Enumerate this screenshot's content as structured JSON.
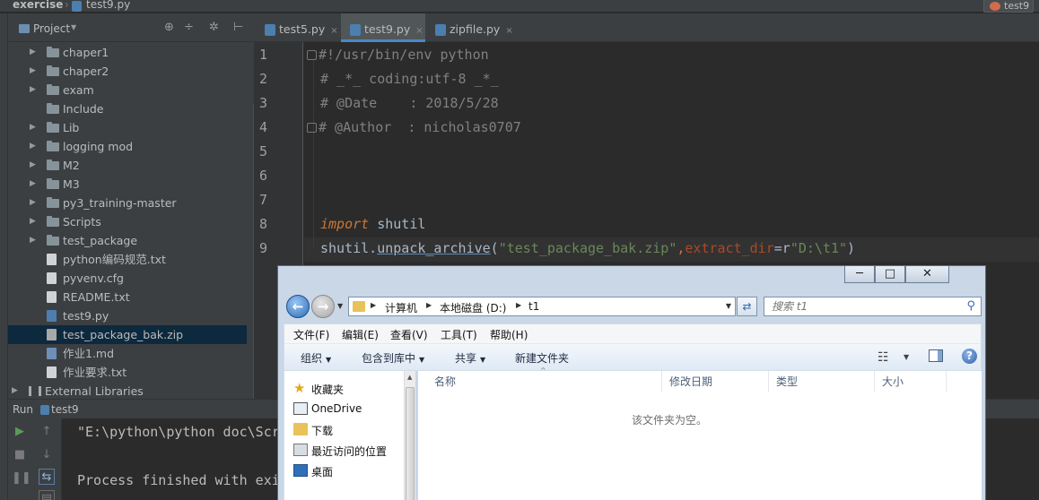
{
  "navbar": {
    "project": "exercise",
    "file": "test9.py",
    "run_config": "test9"
  },
  "project_panel": {
    "title": "Project",
    "tree": [
      {
        "label": "chaper1",
        "type": "folder",
        "indent": 1,
        "arrow": true
      },
      {
        "label": "chaper2",
        "type": "folder",
        "indent": 1,
        "arrow": true
      },
      {
        "label": "exam",
        "type": "folder",
        "indent": 1,
        "arrow": true
      },
      {
        "label": "Include",
        "type": "folder",
        "indent": 1,
        "arrow": false
      },
      {
        "label": "Lib",
        "type": "folder",
        "indent": 1,
        "arrow": true
      },
      {
        "label": "logging mod",
        "type": "folder",
        "indent": 1,
        "arrow": true
      },
      {
        "label": "M2",
        "type": "folder",
        "indent": 1,
        "arrow": true
      },
      {
        "label": "M3",
        "type": "folder",
        "indent": 1,
        "arrow": true
      },
      {
        "label": "py3_training-master",
        "type": "folder",
        "indent": 1,
        "arrow": true
      },
      {
        "label": "Scripts",
        "type": "folder",
        "indent": 1,
        "arrow": true
      },
      {
        "label": "test_package",
        "type": "folder",
        "indent": 1,
        "arrow": true
      },
      {
        "label": "python编码规范.txt",
        "type": "file",
        "indent": 1,
        "arrow": false
      },
      {
        "label": "pyvenv.cfg",
        "type": "file",
        "indent": 1,
        "arrow": false
      },
      {
        "label": "README.txt",
        "type": "file",
        "indent": 1,
        "arrow": false
      },
      {
        "label": "test9.py",
        "type": "py",
        "indent": 1,
        "arrow": false
      },
      {
        "label": "test_package_bak.zip",
        "type": "zip",
        "indent": 1,
        "arrow": false,
        "selected": true
      },
      {
        "label": "作业1.md",
        "type": "md",
        "indent": 1,
        "arrow": false
      },
      {
        "label": "作业要求.txt",
        "type": "file",
        "indent": 1,
        "arrow": false
      },
      {
        "label": "External Libraries",
        "type": "lib",
        "indent": 0,
        "arrow": true
      }
    ]
  },
  "editor": {
    "tabs": [
      {
        "label": "test5.py",
        "active": false
      },
      {
        "label": "test9.py",
        "active": true
      },
      {
        "label": "zipfile.py",
        "active": false
      }
    ],
    "line_numbers": [
      "1",
      "2",
      "3",
      "4",
      "5",
      "6",
      "7",
      "8",
      "9"
    ],
    "code": {
      "l1": "#!/usr/bin/env python",
      "l2": "# _*_ coding:utf-8 _*_",
      "l3": "# @Date    : 2018/5/28",
      "l4": "# @Author  : nicholas0707",
      "l8_kw": "import",
      "l8_mod": " shutil",
      "l9_obj": "shutil.",
      "l9_fn": "unpack_archive",
      "l9_p1": "(",
      "l9_str1": "\"test_package_bak.zip\"",
      "l9_comma": ",",
      "l9_param": "extract_dir",
      "l9_eq": "=r",
      "l9_str2": "\"D:\\t1\"",
      "l9_close": ")"
    }
  },
  "run_panel": {
    "label": "Run",
    "config": "test9",
    "output": [
      "\"E:\\python\\python doc\\Scr",
      "",
      "Process finished with exi"
    ]
  },
  "explorer": {
    "controls": {
      "minimize": "─",
      "maximize": "□",
      "close": "✕"
    },
    "address": [
      "计算机",
      "本地磁盘 (D:)",
      "t1"
    ],
    "search_placeholder": "搜索 t1",
    "menu": [
      "文件(F)",
      "编辑(E)",
      "查看(V)",
      "工具(T)",
      "帮助(H)"
    ],
    "toolbar": [
      "组织",
      "包含到库中",
      "共享",
      "新建文件夹"
    ],
    "nav": [
      "收藏夹",
      "OneDrive",
      "下载",
      "最近访问的位置",
      "桌面"
    ],
    "columns": [
      "名称",
      "修改日期",
      "类型",
      "大小"
    ],
    "empty_message": "该文件夹为空。"
  }
}
